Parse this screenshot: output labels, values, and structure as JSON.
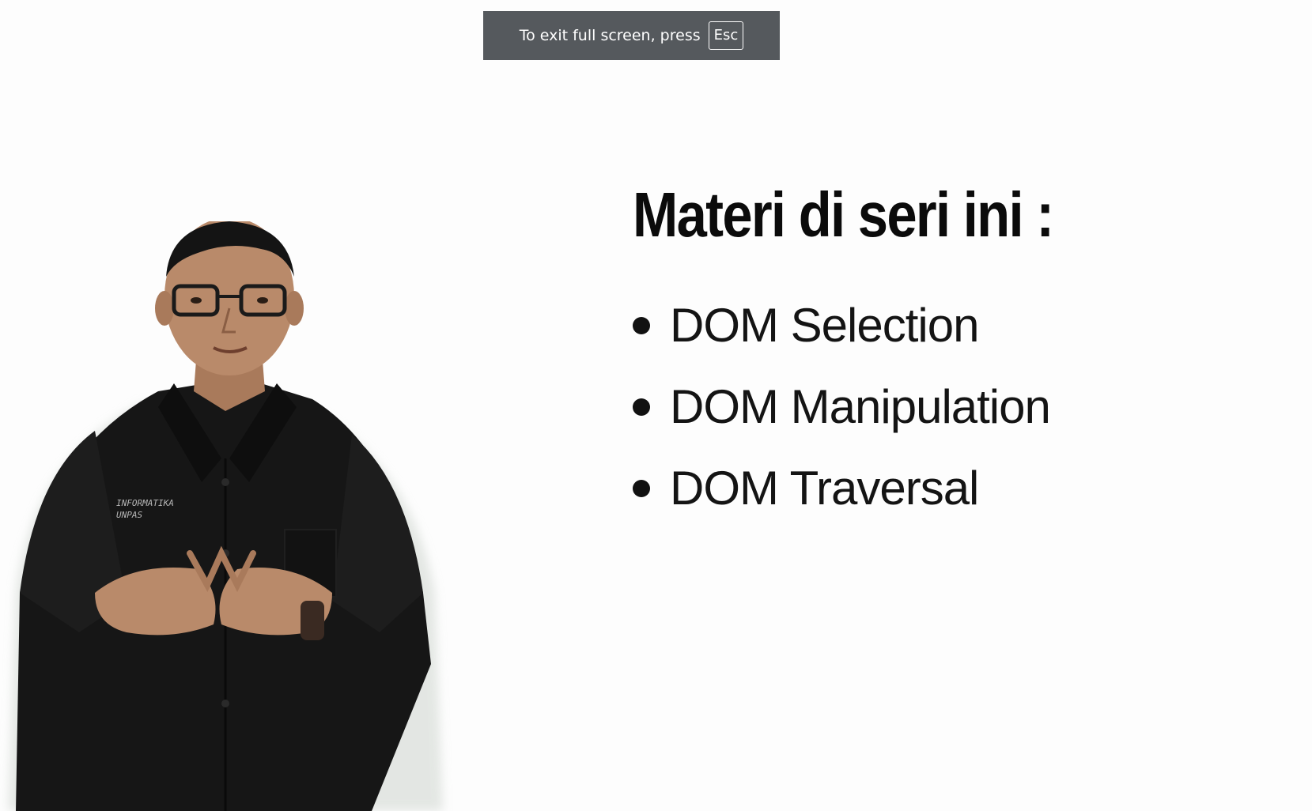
{
  "fullscreen_notice": {
    "text": "To exit full screen, press",
    "key": "Esc"
  },
  "slide": {
    "title": "Materi di seri ini :",
    "topics": [
      "DOM Selection",
      "DOM Manipulation",
      "DOM Traversal"
    ]
  },
  "presenter": {
    "shirt_text_line1": "INFORMATIKA",
    "shirt_text_line2": "UNPAS"
  },
  "colors": {
    "background": "#fdfdfd",
    "toast": "#55595d",
    "text": "#0b0b0b",
    "shirt": "#141414",
    "skin": "#b98a6a"
  }
}
